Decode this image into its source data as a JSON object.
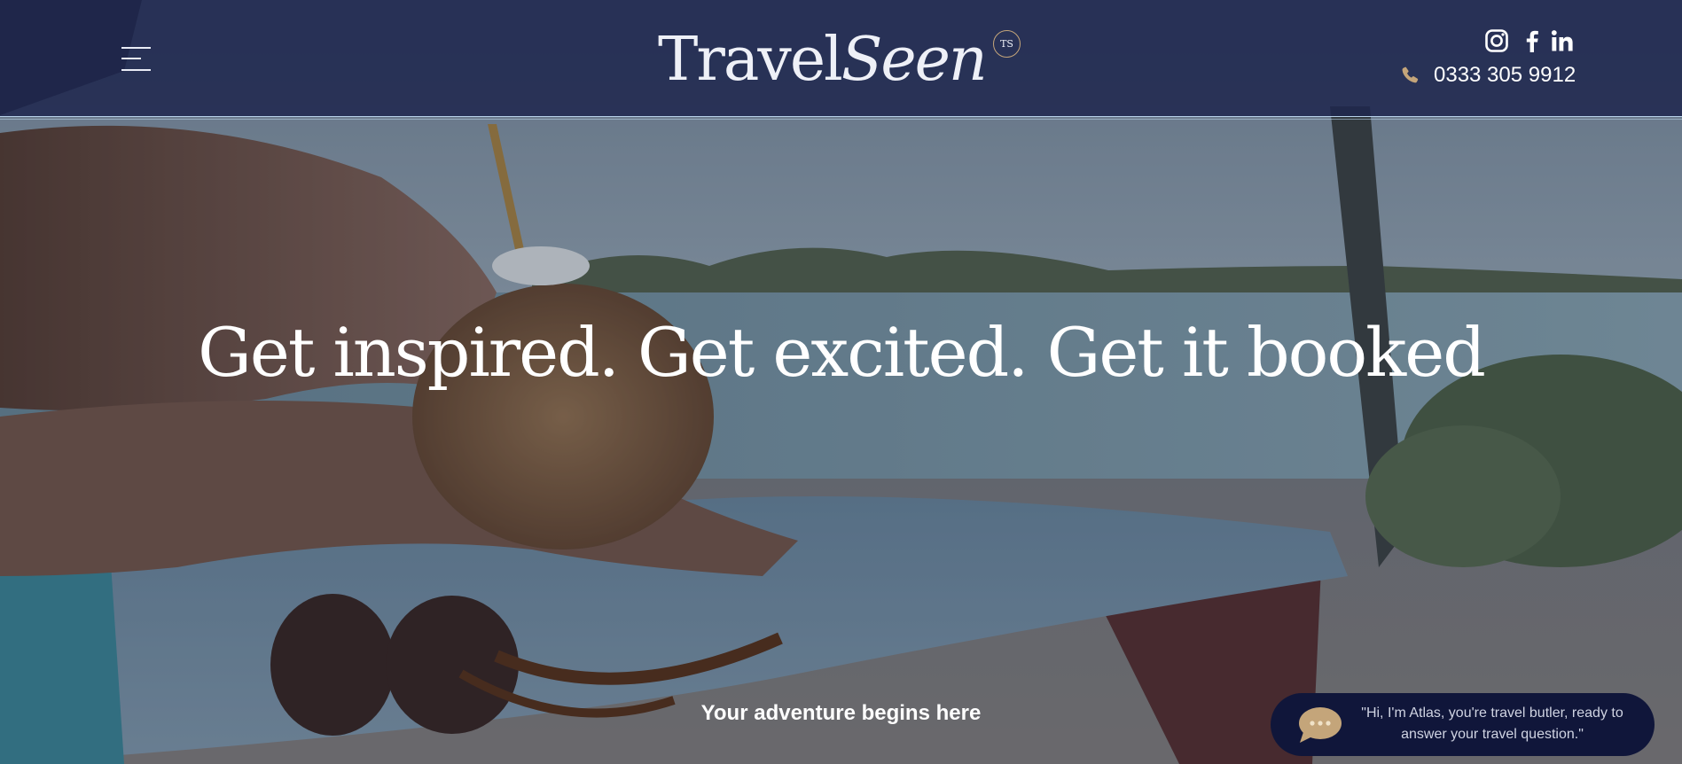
{
  "header": {
    "logo_main": "Travel",
    "logo_accent": "Seen",
    "logo_badge": "TS",
    "phone": "0333 305 9912",
    "icons": {
      "menu": "hamburger-menu-icon",
      "instagram": "instagram-icon",
      "facebook": "facebook-icon",
      "linkedin": "linkedin-icon",
      "phone": "phone-icon"
    }
  },
  "hero": {
    "title": "Get inspired. Get excited. Get it booked",
    "subtitle": "Your adventure begins here"
  },
  "chat": {
    "message": "\"Hi, I'm Atlas, you're travel butler, ready to answer your travel question.\"",
    "icon": "chat-bubble-icon"
  },
  "colors": {
    "header_bg": "#1e264e",
    "accent_gold": "#c4a57a",
    "chat_bg": "#10163a",
    "header_rule": "#b9d3ea"
  }
}
